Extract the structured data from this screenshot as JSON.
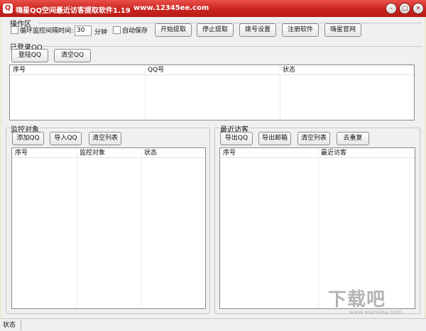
{
  "window": {
    "title": "嗨星QQ空间最近访客提取软件1.19",
    "url": "www.12345ee.com",
    "controls": {
      "min": "–",
      "max": "□",
      "close": "×"
    }
  },
  "ops": {
    "label": "操作区",
    "loop_checkbox": {
      "label": "循环监控间隔时间:",
      "checked": false
    },
    "interval_value": "30",
    "interval_unit": "分钟",
    "autosave_checkbox": {
      "label": "自动保存",
      "checked": false
    },
    "buttons": {
      "start": "开始提取",
      "stop": "停止提取",
      "dial": "拨号设置",
      "register": "注册软件",
      "website": "嗨星官网"
    }
  },
  "logged_qq": {
    "label": "已登录QQ",
    "buttons": {
      "login": "登陆QQ",
      "clear": "清空QQ"
    },
    "columns": [
      "序号",
      "QQ号",
      "状态"
    ]
  },
  "monitor": {
    "label": "监控对象",
    "buttons": {
      "add": "添加QQ",
      "import": "导入QQ",
      "clear": "清空列表"
    },
    "columns": [
      "序号",
      "监控对象",
      "状态"
    ]
  },
  "visitors": {
    "label": "最近访客",
    "buttons": {
      "export_qq": "导出QQ",
      "export_mail": "导出邮箱",
      "clear": "清空列表",
      "dedupe": "去重复"
    },
    "columns": [
      "序号",
      "最近访客"
    ]
  },
  "statusbar": {
    "label": "状态"
  },
  "watermark": {
    "big": "下载吧",
    "small": "www.xiazaiba.com"
  },
  "icons": {
    "app": "app-icon"
  }
}
